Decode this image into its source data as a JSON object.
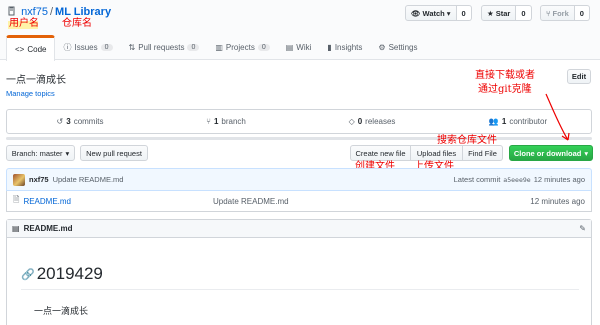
{
  "repo": {
    "owner": "nxf75",
    "separator": "/",
    "name": "ML Library"
  },
  "actions": {
    "watch": {
      "label": "Watch",
      "count": "0"
    },
    "star": {
      "label": "Star",
      "count": "0"
    },
    "fork": {
      "label": "Fork",
      "count": "0"
    }
  },
  "tabs": [
    {
      "label": "Code",
      "count": null,
      "icon": "code-icon"
    },
    {
      "label": "Issues",
      "count": "0",
      "icon": "issue-icon"
    },
    {
      "label": "Pull requests",
      "count": "0",
      "icon": "pull-request-icon"
    },
    {
      "label": "Projects",
      "count": "0",
      "icon": "project-icon"
    },
    {
      "label": "Wiki",
      "count": null,
      "icon": "wiki-icon"
    },
    {
      "label": "Insights",
      "count": null,
      "icon": "graph-icon"
    },
    {
      "label": "Settings",
      "count": null,
      "icon": "gear-icon"
    }
  ],
  "description": "一点一滴成长",
  "manage_topics": "Manage topics",
  "edit_label": "Edit",
  "summary": {
    "commits": {
      "num": "3",
      "label": "commits"
    },
    "branches": {
      "num": "1",
      "label": "branch"
    },
    "releases": {
      "num": "0",
      "label": "releases"
    },
    "contributors": {
      "num": "1",
      "label": "contributor"
    }
  },
  "file_nav": {
    "branch": "Branch: master",
    "new_pr": "New pull request",
    "create_file": "Create new file",
    "upload_files": "Upload files",
    "find_file": "Find File",
    "clone": "Clone or download"
  },
  "latest_commit": {
    "author": "nxf75",
    "message": "Update README.md",
    "prefix": "Latest commit",
    "sha": "a5eee9e",
    "time": "12 minutes ago"
  },
  "files": [
    {
      "name": "README.md",
      "message": "Update README.md",
      "time": "12 minutes ago"
    }
  ],
  "readme": {
    "filename": "README.md",
    "heading": "2019429",
    "paragraph": "一点一滴成长"
  },
  "annotations": {
    "username": "用户名",
    "repo_name": "仓库名",
    "download_line1": "直接下载或者",
    "download_line2": "通过git克隆",
    "search_files": "搜索仓库文件",
    "create_file": "创建文件",
    "upload_file": "上传文件"
  },
  "colors": {
    "link": "#0366d6",
    "tab_accent": "#e36209",
    "clone_green": "#28a745",
    "annotation_red": "#e00000"
  }
}
